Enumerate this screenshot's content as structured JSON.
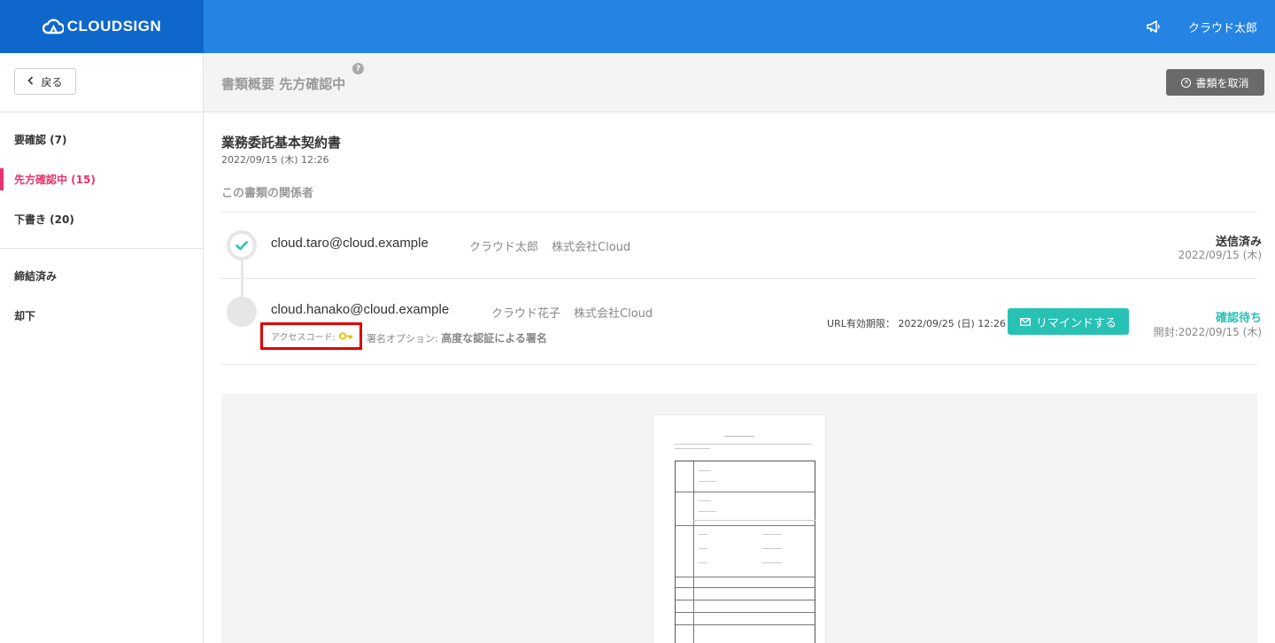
{
  "header": {
    "logo_text": "CLOUDSIGN",
    "user_name": "クラウド太郎"
  },
  "sidebar": {
    "back_label": "戻る",
    "groups": [
      [
        {
          "label": "要確認 (7)",
          "active": false
        },
        {
          "label": "先方確認中 (15)",
          "active": true
        },
        {
          "label": "下書き (20)",
          "active": false
        }
      ],
      [
        {
          "label": "締結済み",
          "active": false
        },
        {
          "label": "却下",
          "active": false
        }
      ]
    ]
  },
  "topbar": {
    "title": "書類概要 先方確認中",
    "help": "?",
    "cancel_label": "書類を取消"
  },
  "document": {
    "title": "業務委託基本契約書",
    "date": "2022/09/15 (木) 12:26",
    "section_label": "この書類の関係者"
  },
  "parties": [
    {
      "email": "cloud.taro@cloud.example",
      "name": "クラウド太郎",
      "company": "株式会社Cloud",
      "status": "送信済み",
      "status_date": "2022/09/15 (木)",
      "status_color": "#333333"
    },
    {
      "email": "cloud.hanako@cloud.example",
      "name": "クラウド花子",
      "company": "株式会社Cloud",
      "access_code_label": "アクセスコード:",
      "sign_option_label": "署名オプション:",
      "sign_option_value": "高度な認証による署名",
      "url_expiry": "URL有効期限： 2022/09/25 (日) 12:26",
      "remind_label": "リマインドする",
      "status": "確認待ち",
      "status_date": "開封:2022/09/15 (木)",
      "status_color": "#28c2b5"
    }
  ],
  "colors": {
    "header_blue": "#2584e3",
    "logo_blue": "#0f67cc",
    "active_pink": "#e8336d",
    "teal": "#28c2b5",
    "highlight_red": "#e00000"
  },
  "icons": {
    "logo": "cloud-logo-icon",
    "announcement": "megaphone-icon",
    "back": "chevron-left-icon",
    "help": "question-icon",
    "cancel": "x-circle-icon",
    "done": "check-icon",
    "access_code": "key-icon",
    "remind": "envelope-icon"
  }
}
